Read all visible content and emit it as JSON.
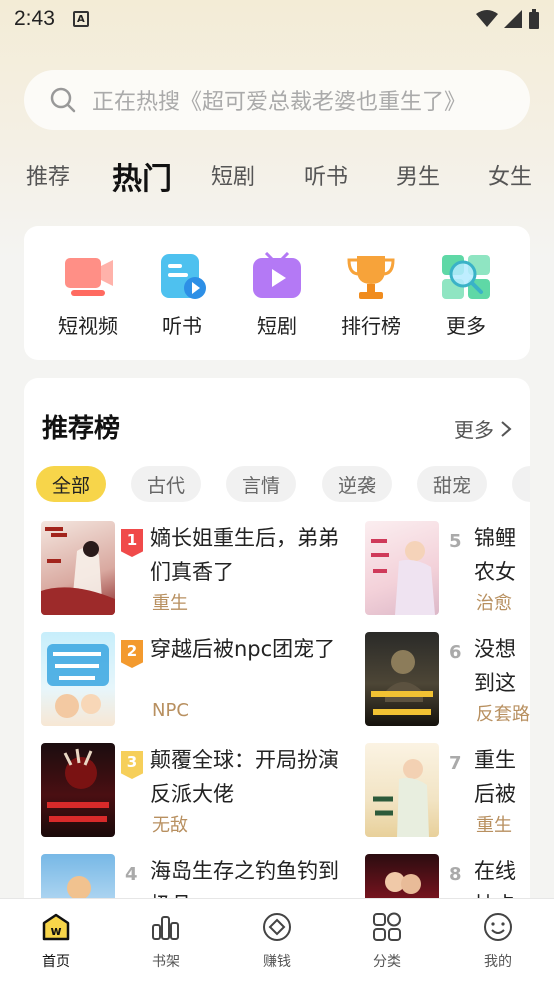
{
  "status": {
    "time": "2:43"
  },
  "search": {
    "placeholder": "正在热搜《超可爱总裁老婆也重生了》"
  },
  "tabs": [
    "推荐",
    "热门",
    "短剧",
    "听书",
    "男生",
    "女生"
  ],
  "active_tab": "热门",
  "quick_entries": [
    {
      "label": "短视频",
      "icon": "video-icon"
    },
    {
      "label": "听书",
      "icon": "audiobook-icon"
    },
    {
      "label": "短剧",
      "icon": "drama-play-icon"
    },
    {
      "label": "排行榜",
      "icon": "trophy-icon"
    },
    {
      "label": "更多",
      "icon": "search-more-icon"
    }
  ],
  "ranking": {
    "title": "推荐榜",
    "more": "更多",
    "chips": [
      "全部",
      "古代",
      "言情",
      "逆袭",
      "甜宠"
    ],
    "books": [
      {
        "rank": "1",
        "title": "嫡长姐重生后，弟弟们真香了",
        "tag": "重生"
      },
      {
        "rank": "2",
        "title": "穿越后被npc团宠了",
        "tag": "NPC"
      },
      {
        "rank": "3",
        "title": "颠覆全球：开局扮演反派大佬",
        "tag": "无敌"
      },
      {
        "rank": "4",
        "title": "海岛生存之钓鱼钓到极品",
        "tag": ""
      },
      {
        "rank": "5",
        "title": "锦鲤农女的心头宠",
        "tag": "治愈"
      },
      {
        "rank": "6",
        "title": "没想到这才是贵族",
        "tag": "反套路"
      },
      {
        "rank": "7",
        "title": "重生后被团宠小",
        "tag": "重生"
      },
      {
        "rank": "8",
        "title": "在线抽卡都将",
        "tag": ""
      }
    ]
  },
  "bottom_nav": [
    {
      "label": "首页",
      "icon": "home-icon"
    },
    {
      "label": "书架",
      "icon": "bookshelf-icon"
    },
    {
      "label": "赚钱",
      "icon": "earn-icon"
    },
    {
      "label": "分类",
      "icon": "category-icon"
    },
    {
      "label": "我的",
      "icon": "profile-icon"
    }
  ],
  "colors": {
    "accent": "#f7d54a",
    "tag": "#b89060",
    "badge1": "#f04a4a",
    "badge2": "#f39a2e",
    "badge3": "#f6cf5a"
  }
}
